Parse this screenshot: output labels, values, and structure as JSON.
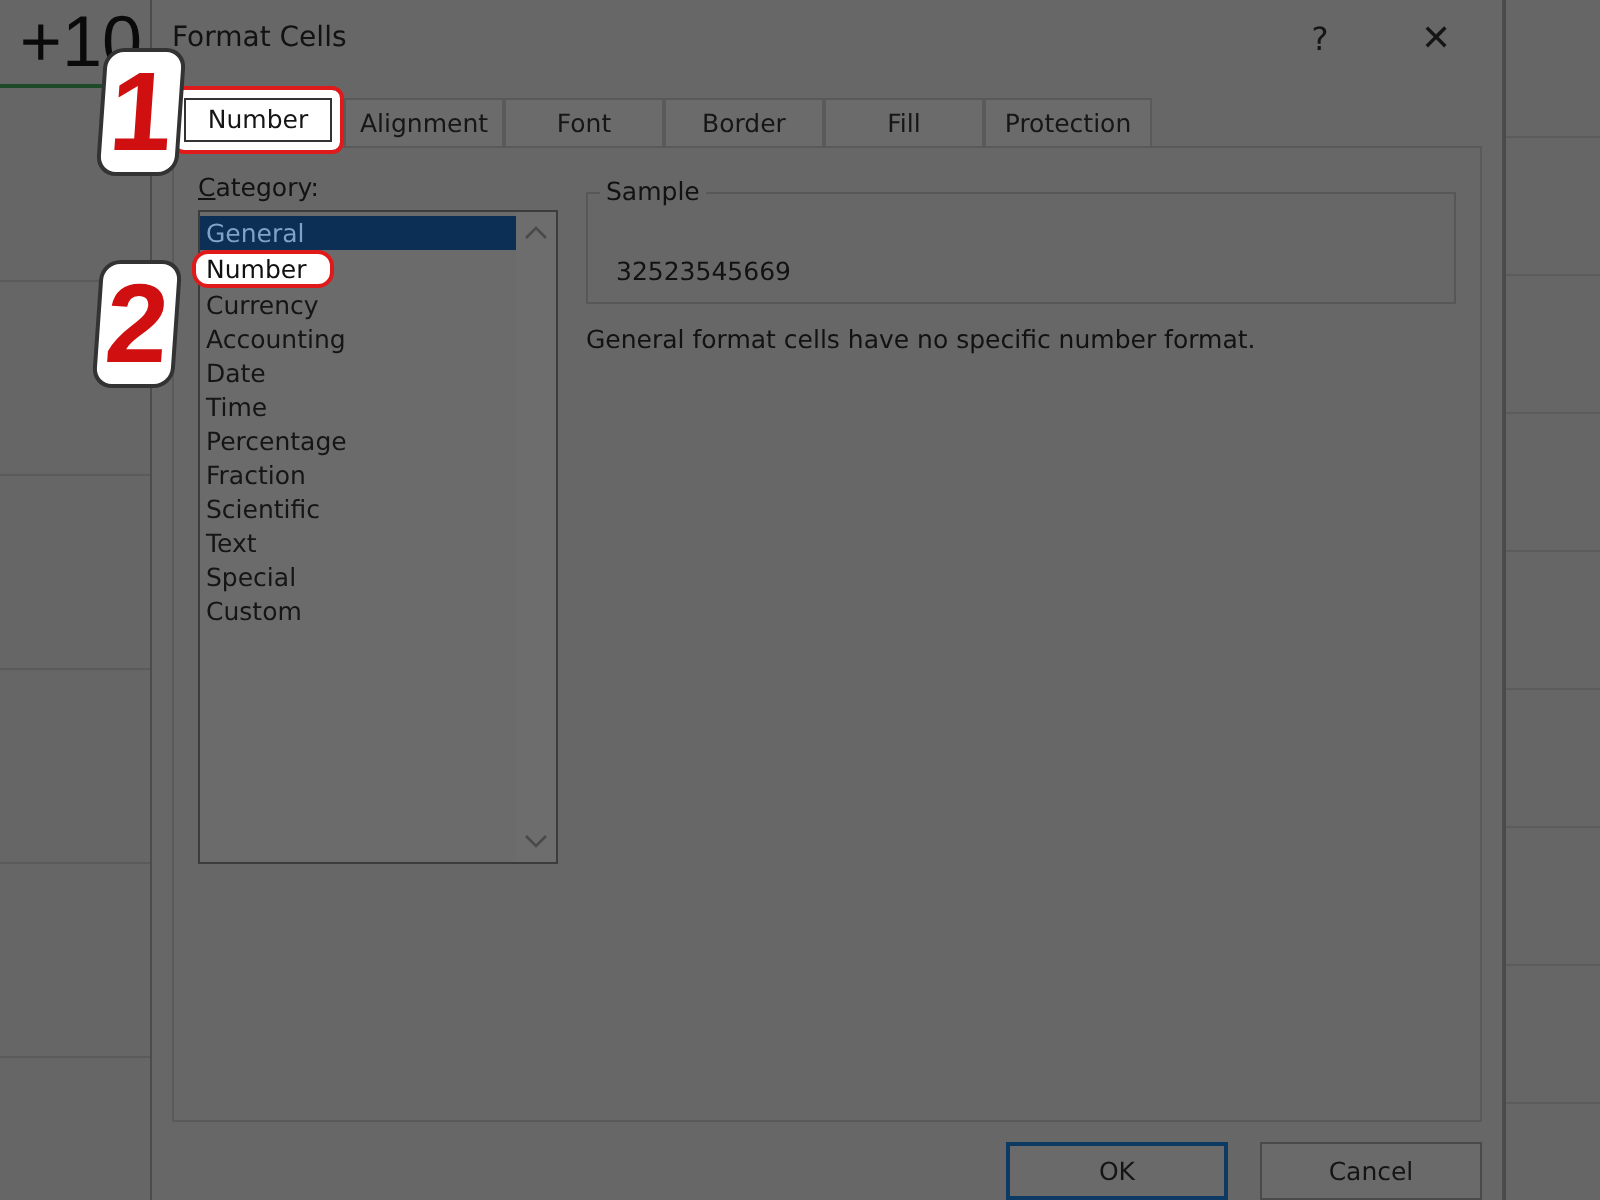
{
  "spreadsheet": {
    "cell_text": "+10"
  },
  "dialog": {
    "title": "Format Cells",
    "help": "?",
    "close": "✕",
    "tabs": [
      {
        "label": "Number",
        "selected": true
      },
      {
        "label": "Alignment",
        "selected": false
      },
      {
        "label": "Font",
        "selected": false
      },
      {
        "label": "Border",
        "selected": false
      },
      {
        "label": "Fill",
        "selected": false
      },
      {
        "label": "Protection",
        "selected": false
      }
    ],
    "category_label": "Category:",
    "categories": [
      {
        "label": "General",
        "selected": true,
        "highlighted": false
      },
      {
        "label": "Number",
        "selected": false,
        "highlighted": true
      },
      {
        "label": "Currency",
        "selected": false,
        "highlighted": false
      },
      {
        "label": "Accounting",
        "selected": false,
        "highlighted": false
      },
      {
        "label": "Date",
        "selected": false,
        "highlighted": false
      },
      {
        "label": "Time",
        "selected": false,
        "highlighted": false
      },
      {
        "label": "Percentage",
        "selected": false,
        "highlighted": false
      },
      {
        "label": "Fraction",
        "selected": false,
        "highlighted": false
      },
      {
        "label": "Scientific",
        "selected": false,
        "highlighted": false
      },
      {
        "label": "Text",
        "selected": false,
        "highlighted": false
      },
      {
        "label": "Special",
        "selected": false,
        "highlighted": false
      },
      {
        "label": "Custom",
        "selected": false,
        "highlighted": false
      }
    ],
    "sample": {
      "legend": "Sample",
      "value": "32523545669"
    },
    "description": "General format cells have no specific number format.",
    "buttons": [
      {
        "label": "OK",
        "default": true
      },
      {
        "label": "Cancel",
        "default": false
      }
    ]
  },
  "annotations": [
    {
      "label": "1"
    },
    {
      "label": "2"
    }
  ]
}
